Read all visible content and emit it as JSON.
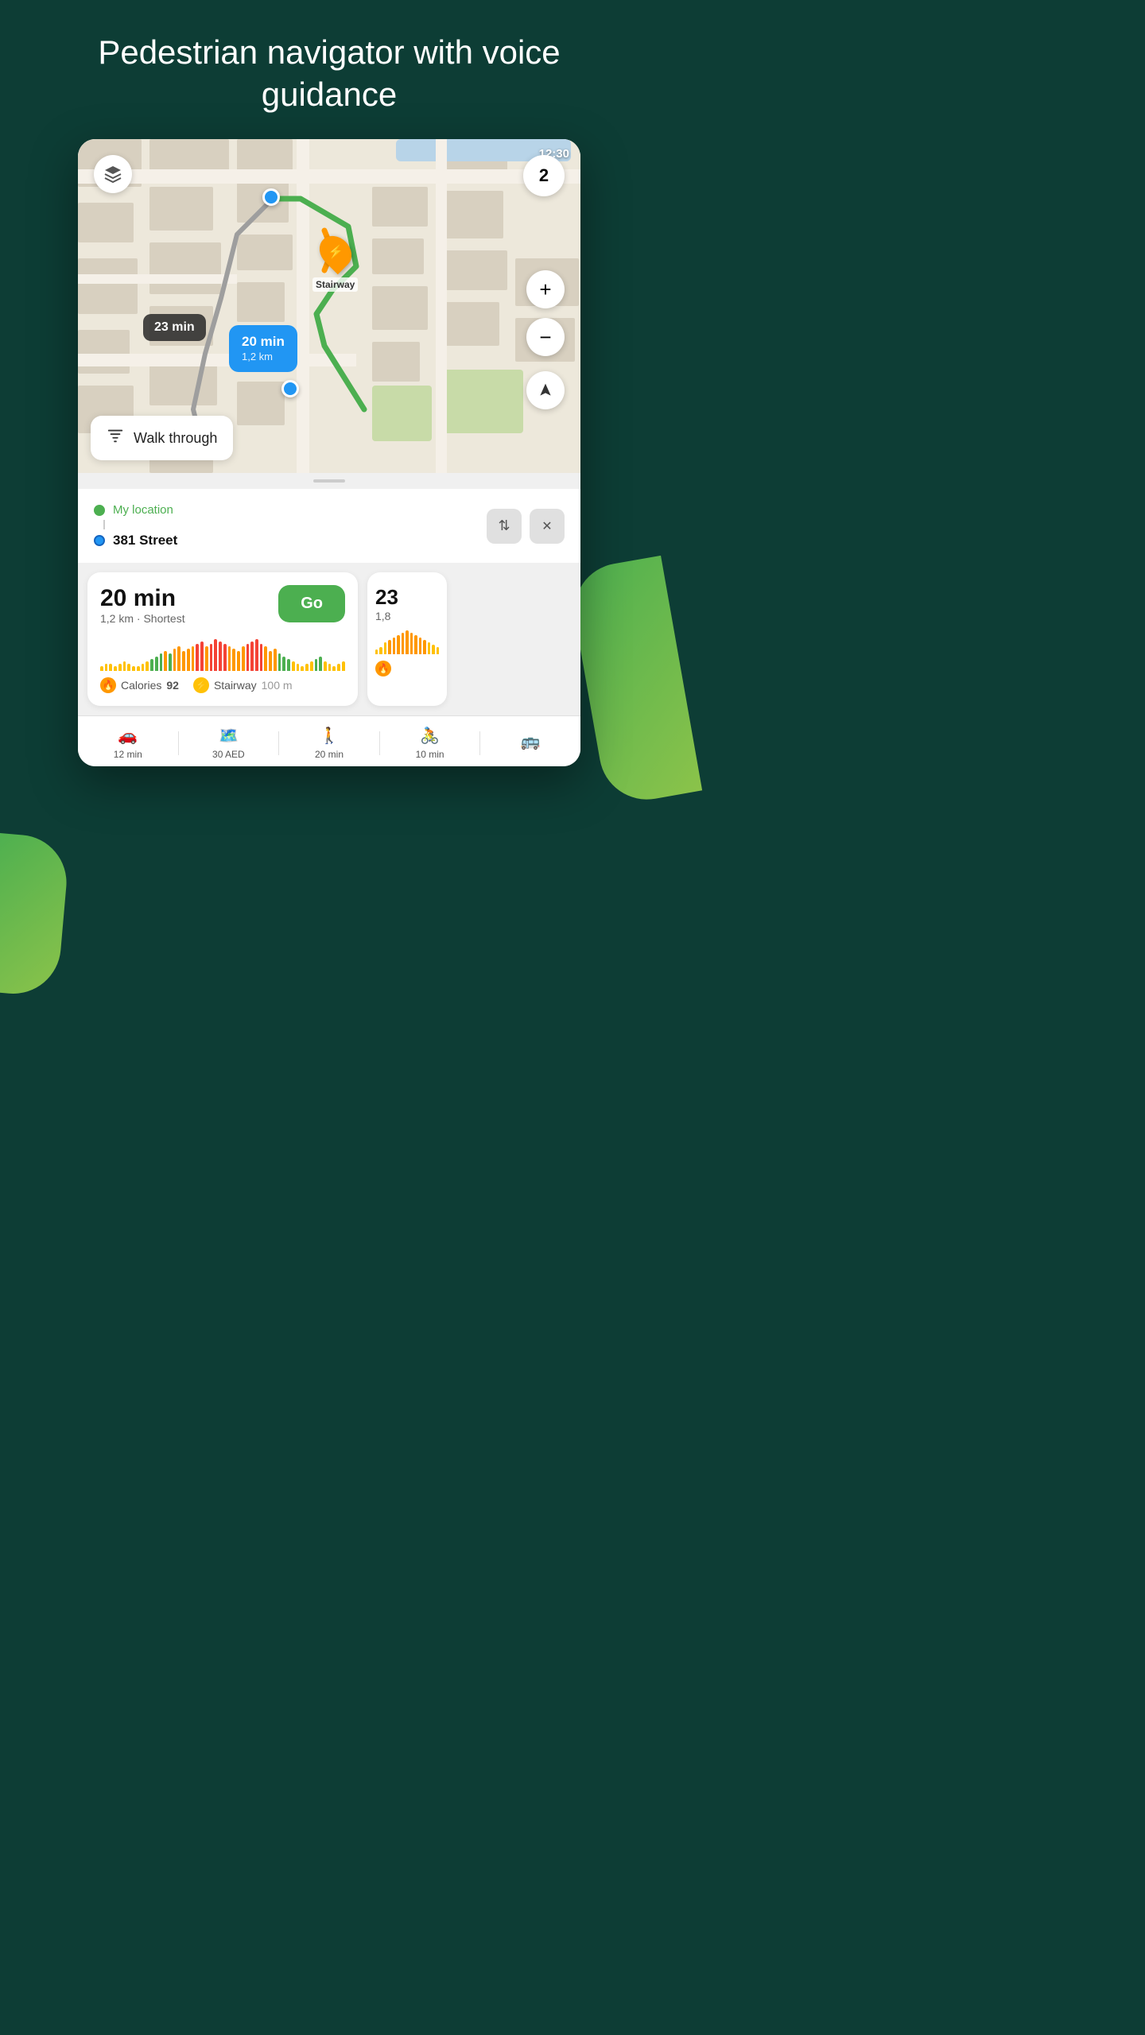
{
  "header": {
    "title": "Pedestrian navigator with voice guidance"
  },
  "map": {
    "time": "12:30",
    "badge_number": "2",
    "layers_icon": "☰",
    "zoom_in_label": "+",
    "zoom_out_label": "−",
    "nav_icon": "▶",
    "tooltip_dark": "23 min",
    "tooltip_blue_time": "20 min",
    "tooltip_blue_dist": "1,2 km",
    "stairway_label": "Stairway",
    "walk_through_label": "Walk through"
  },
  "location": {
    "my_location": "My location",
    "destination": "381 Street",
    "swap_icon": "⇅",
    "close_icon": "✕"
  },
  "routes": [
    {
      "time": "20 min",
      "distance": "1,2 km",
      "type": "Shortest",
      "go_label": "Go",
      "calories_label": "Calories",
      "calories_value": "92",
      "stairway_label": "Stairway",
      "stairway_value": "100 m",
      "elevation_bars": [
        2,
        3,
        3,
        2,
        3,
        4,
        3,
        2,
        2,
        3,
        4,
        5,
        6,
        7,
        8,
        7,
        9,
        10,
        8,
        9,
        10,
        11,
        12,
        10,
        11,
        13,
        12,
        11,
        10,
        9,
        8,
        10,
        11,
        12,
        13,
        11,
        10,
        8,
        9,
        7,
        6,
        5,
        4,
        3,
        2,
        3,
        4,
        5,
        6,
        4,
        3,
        2,
        3,
        4
      ]
    },
    {
      "time": "23",
      "distance": "1,8",
      "type": "",
      "elevation_bars": [
        2,
        3,
        5,
        6,
        7,
        8,
        9,
        10,
        9,
        8,
        7,
        6,
        5,
        4,
        3
      ]
    }
  ],
  "bottom_tabs": [
    {
      "icon": "🚗",
      "label": "12 min"
    },
    {
      "icon": "🗺️",
      "label": "30 AED"
    },
    {
      "icon": "🚶",
      "label": "20 min"
    },
    {
      "icon": "🚴",
      "label": "10 min"
    },
    {
      "icon": "🚌",
      "label": ""
    }
  ],
  "colors": {
    "dark_green_bg": "#0d3d35",
    "route_green": "#4CAF50",
    "route_orange": "#FF9800",
    "route_red": "#f44336",
    "accent_blue": "#2196F3",
    "go_btn": "#4CAF50"
  }
}
